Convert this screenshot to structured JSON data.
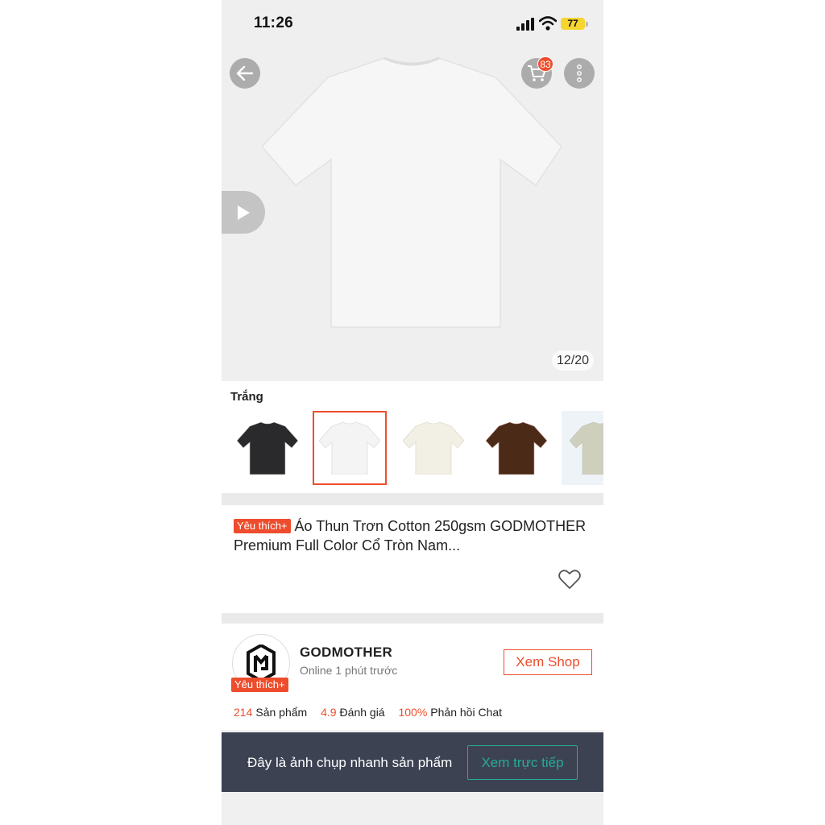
{
  "status_bar": {
    "time": "11:26",
    "battery": "77"
  },
  "product_gallery": {
    "counter": "12/20",
    "cart_count": "83"
  },
  "variants": {
    "selected_label": "Trắng",
    "colors": [
      "#2a2a2c",
      "#f4f4f4",
      "#f2efe4",
      "#4b2a18",
      "#cfcfbd"
    ]
  },
  "product": {
    "badge": "Yêu thích+",
    "title": "Áo Thun Trơn Cotton 250gsm GODMOTHER Premium Full Color Cổ Tròn Nam..."
  },
  "shop": {
    "name": "GODMOTHER",
    "online_status": "Online 1 phút trước",
    "badge": "Yêu thích+",
    "view_button": "Xem Shop",
    "stats": {
      "products_count": "214",
      "products_label": "Sản phẩm",
      "rating_value": "4.9",
      "rating_label": "Đánh giá",
      "chat_response": "100%",
      "chat_label": "Phản hồi Chat"
    }
  },
  "snapshot_banner": {
    "text": "Đây là ảnh chụp nhanh sản phẩm",
    "button": "Xem trực tiếp"
  },
  "colors": {
    "accent": "#ee4d2d",
    "teal": "#26aa99",
    "banner_bg": "#3c4252"
  }
}
